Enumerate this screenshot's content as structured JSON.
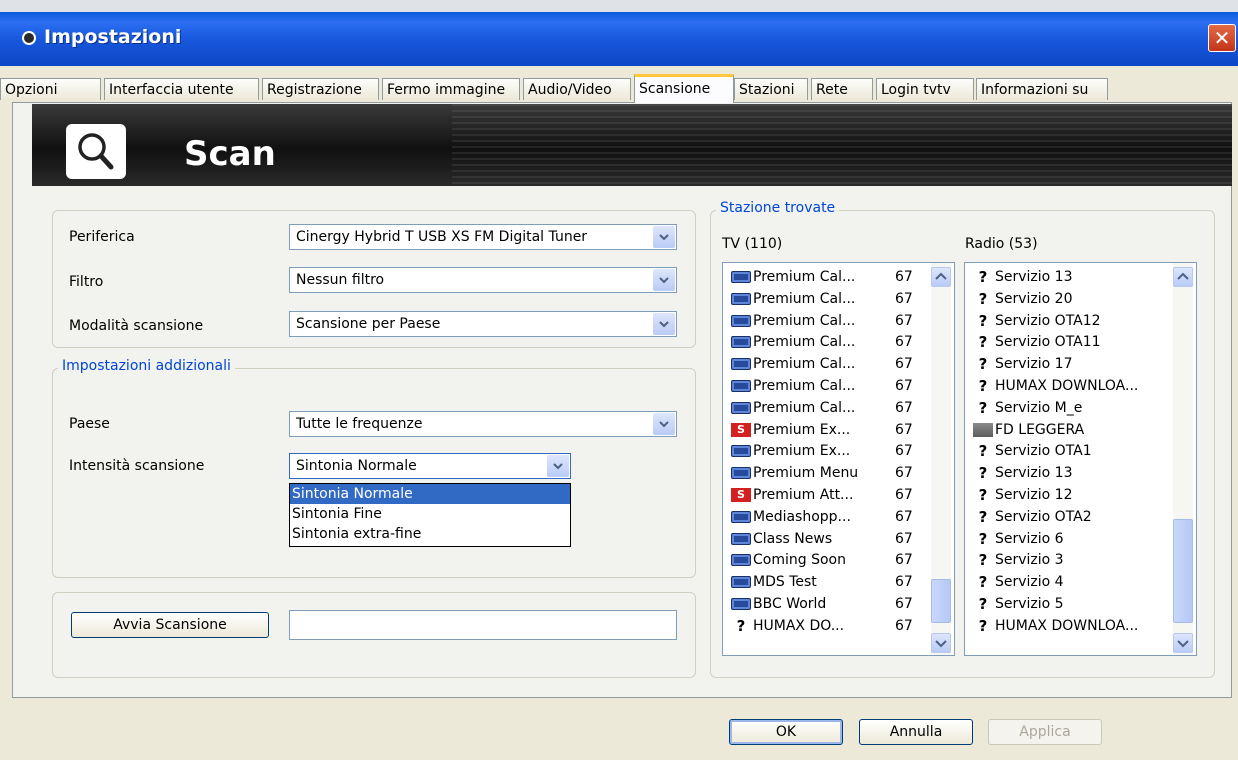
{
  "window": {
    "title": "Impostazioni",
    "close_glyph": "✕"
  },
  "tabs": [
    {
      "label": "Opzioni"
    },
    {
      "label": "Interfaccia utente"
    },
    {
      "label": "Registrazione"
    },
    {
      "label": "Fermo immagine"
    },
    {
      "label": "Audio/Video"
    },
    {
      "label": "Scansione",
      "active": true
    },
    {
      "label": "Stazioni"
    },
    {
      "label": "Rete"
    },
    {
      "label": "Login tvtv"
    },
    {
      "label": "Informazioni su"
    }
  ],
  "banner": {
    "title": "Scan",
    "icon": "magnifier-icon"
  },
  "device": {
    "periferica_label": "Periferica",
    "periferica_value": "Cinergy Hybrid T USB XS FM Digital Tuner",
    "filtro_label": "Filtro",
    "filtro_value": "Nessun filtro",
    "modalita_label": "Modalità scansione",
    "modalita_value": "Scansione per Paese"
  },
  "additional": {
    "legend": "Impostazioni addizionali",
    "paese_label": "Paese",
    "paese_value": "Tutte le frequenze",
    "intensita_label": "Intensità scansione",
    "intensita_value": "Sintonia Normale",
    "intensita_options": [
      "Sintonia Normale",
      "Sintonia Fine",
      "Sintonia extra-fine"
    ]
  },
  "scan": {
    "button_label": "Avvia Scansione",
    "progress_value": ""
  },
  "found": {
    "legend": "Stazione trovate",
    "tv_header": "TV (110)",
    "radio_header": "Radio (53)",
    "tv": [
      {
        "icon": "tv",
        "name": "Premium Cal...",
        "num": "67"
      },
      {
        "icon": "tv",
        "name": "Premium Cal...",
        "num": "67"
      },
      {
        "icon": "tv",
        "name": "Premium Cal...",
        "num": "67"
      },
      {
        "icon": "tv",
        "name": "Premium Cal...",
        "num": "67"
      },
      {
        "icon": "tv",
        "name": "Premium Cal...",
        "num": "67"
      },
      {
        "icon": "tv",
        "name": "Premium Cal...",
        "num": "67"
      },
      {
        "icon": "tv",
        "name": "Premium Cal...",
        "num": "67"
      },
      {
        "icon": "s",
        "name": "Premium Ex...",
        "num": "67"
      },
      {
        "icon": "tv",
        "name": "Premium Ex...",
        "num": "67"
      },
      {
        "icon": "tv",
        "name": "Premium Menu",
        "num": "67"
      },
      {
        "icon": "s",
        "name": "Premium Att...",
        "num": "67"
      },
      {
        "icon": "tv",
        "name": "Mediashopp...",
        "num": "67"
      },
      {
        "icon": "tv",
        "name": "Class News",
        "num": "67"
      },
      {
        "icon": "tv",
        "name": "Coming Soon",
        "num": "67"
      },
      {
        "icon": "tv",
        "name": "MDS Test",
        "num": "67"
      },
      {
        "icon": "tv",
        "name": "BBC World",
        "num": "67"
      },
      {
        "icon": "q",
        "name": "HUMAX DO...",
        "num": "67"
      }
    ],
    "radio": [
      {
        "icon": "q",
        "name": "Servizio 13"
      },
      {
        "icon": "q",
        "name": "Servizio 20"
      },
      {
        "icon": "q",
        "name": "Servizio OTA12"
      },
      {
        "icon": "q",
        "name": "Servizio OTA11"
      },
      {
        "icon": "q",
        "name": "Servizio 17"
      },
      {
        "icon": "q",
        "name": "HUMAX DOWNLOA..."
      },
      {
        "icon": "q",
        "name": "Servizio M_e"
      },
      {
        "icon": "radio",
        "name": "FD LEGGERA"
      },
      {
        "icon": "q",
        "name": "Servizio OTA1"
      },
      {
        "icon": "q",
        "name": "Servizio 13"
      },
      {
        "icon": "q",
        "name": "Servizio 12"
      },
      {
        "icon": "q",
        "name": "Servizio OTA2"
      },
      {
        "icon": "q",
        "name": "Servizio 6"
      },
      {
        "icon": "q",
        "name": "Servizio 3"
      },
      {
        "icon": "q",
        "name": "Servizio 4"
      },
      {
        "icon": "q",
        "name": "Servizio 5"
      },
      {
        "icon": "q",
        "name": "HUMAX DOWNLOA..."
      }
    ]
  },
  "footer": {
    "ok_label": "OK",
    "cancel_label": "Annulla",
    "apply_label": "Applica"
  }
}
